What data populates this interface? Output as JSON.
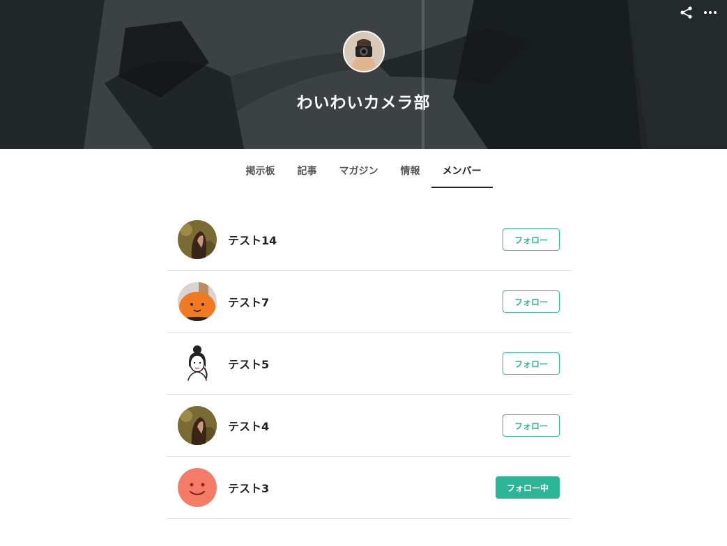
{
  "header": {
    "circle_name": "わいわいカメラ部",
    "share_icon": "share-icon",
    "more_icon": "more-icon"
  },
  "tabs": [
    {
      "label": "掲示板",
      "active": false
    },
    {
      "label": "記事",
      "active": false
    },
    {
      "label": "マガジン",
      "active": false
    },
    {
      "label": "情報",
      "active": false
    },
    {
      "label": "メンバー",
      "active": true
    }
  ],
  "members": [
    {
      "name": "テスト14",
      "avatar": "photo-woman-hair",
      "button": "フォロー",
      "following": false
    },
    {
      "name": "テスト7",
      "avatar": "pumpkin-icon",
      "button": "フォロー",
      "following": false
    },
    {
      "name": "テスト5",
      "avatar": "illustration-woman",
      "button": "フォロー",
      "following": false
    },
    {
      "name": "テスト4",
      "avatar": "photo-woman-hair",
      "button": "フォロー",
      "following": false
    },
    {
      "name": "テスト3",
      "avatar": "smiley-face-icon",
      "button": "フォロー中",
      "following": true
    }
  ],
  "colors": {
    "accent": "#2cb696",
    "hero_bg": "#2f3536",
    "smiley": "#f47c66",
    "pumpkin": "#f07a22"
  }
}
